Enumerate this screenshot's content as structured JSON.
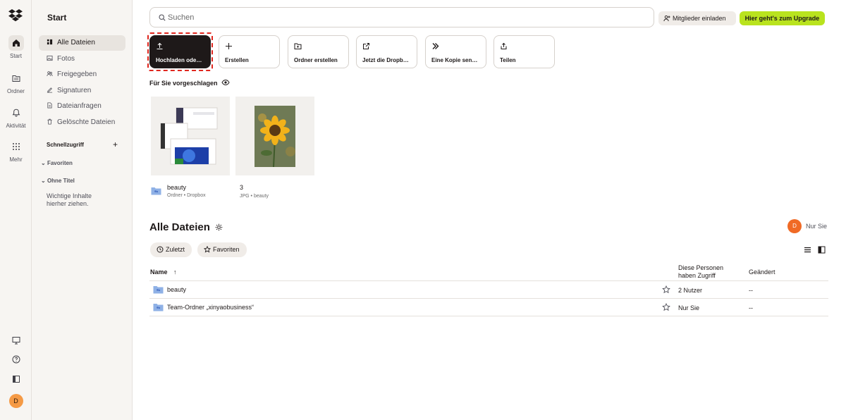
{
  "rail": {
    "items": [
      {
        "label": "Start",
        "icon": "home-icon"
      },
      {
        "label": "Ordner",
        "icon": "folder-icon"
      },
      {
        "label": "Aktivität",
        "icon": "bell-icon"
      },
      {
        "label": "Mehr",
        "icon": "grid-icon"
      }
    ],
    "avatar_initial": "D"
  },
  "sidebar": {
    "title": "Start",
    "items": [
      {
        "label": "Alle Dateien",
        "icon": "files-icon"
      },
      {
        "label": "Fotos",
        "icon": "photo-icon"
      },
      {
        "label": "Freigegeben",
        "icon": "shared-icon"
      },
      {
        "label": "Signaturen",
        "icon": "signature-icon"
      },
      {
        "label": "Dateianfragen",
        "icon": "file-request-icon"
      },
      {
        "label": "Gelöschte Dateien",
        "icon": "trash-icon"
      }
    ],
    "quick_access": "Schnellzugriff",
    "favorites": "Favoriten",
    "untitled": "Ohne Titel",
    "hint": "Wichtige Inhalte hierher ziehen."
  },
  "topbar": {
    "search_placeholder": "Suchen",
    "invite_label": "Mitglieder einladen",
    "upgrade_label": "Hier geht's zum Upgrade",
    "upgrade_color": "#b9e31e"
  },
  "actions": [
    {
      "label": "Hochladen ode…",
      "icon": "upload-icon"
    },
    {
      "label": "Erstellen",
      "icon": "plus-icon"
    },
    {
      "label": "Ordner erstellen",
      "icon": "new-folder-icon"
    },
    {
      "label": "Jetzt die Dropb…",
      "icon": "external-link-icon"
    },
    {
      "label": "Eine Kopie sen…",
      "icon": "transfer-icon"
    },
    {
      "label": "Teilen",
      "icon": "share-icon"
    }
  ],
  "suggestions": {
    "title": "Für Sie vorgeschlagen",
    "items": [
      {
        "name": "beauty",
        "meta": "Ordner • Dropbox"
      },
      {
        "name": "3",
        "meta": "JPG • beauty"
      }
    ]
  },
  "files": {
    "title": "Alle Dateien",
    "owner_initial": "D",
    "owner_label": "Nur Sie",
    "filters": [
      "Zuletzt",
      "Favoriten"
    ],
    "columns": {
      "name": "Name",
      "access": "Diese Personen haben Zugriff",
      "changed": "Geändert"
    },
    "rows": [
      {
        "name": "beauty",
        "access": "2 Nutzer",
        "changed": "--"
      },
      {
        "name": "Team-Ordner „xinyaobusiness“",
        "access": "Nur Sie",
        "changed": "--"
      }
    ]
  }
}
